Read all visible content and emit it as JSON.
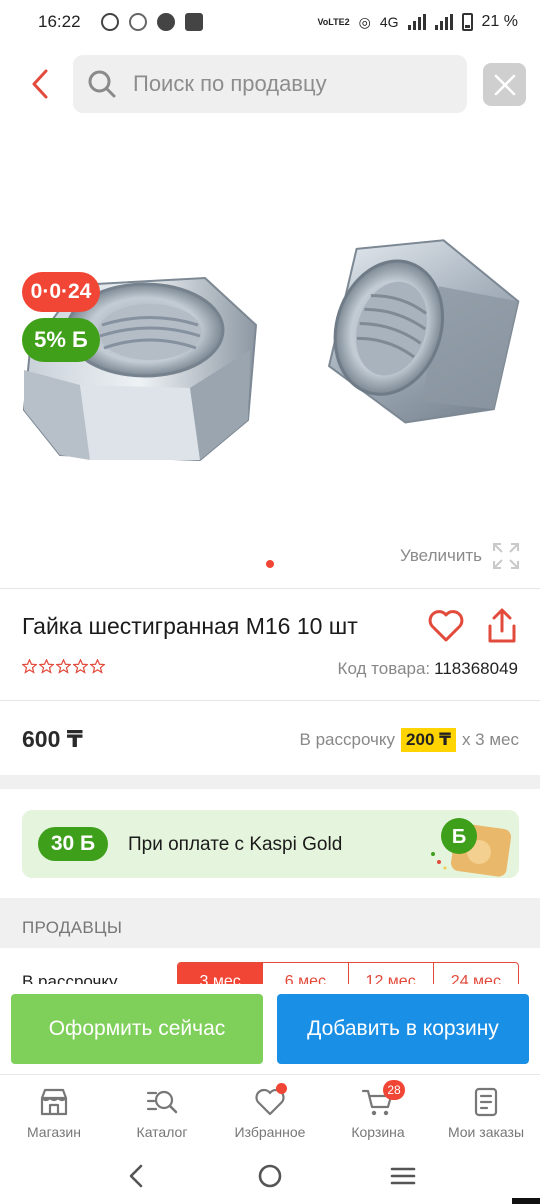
{
  "status_bar": {
    "time": "16:22",
    "network": "4G",
    "volte": "VoLTE2",
    "battery": "21 %"
  },
  "header": {
    "search_placeholder": "Поиск по продавцу",
    "back_icon": "chevron-left-icon",
    "close_icon": "close-icon"
  },
  "product": {
    "timer_badge": "0·0·24",
    "bonus_badge": "5% Б",
    "zoom_label": "Увеличить",
    "title": "Гайка шестигранная М16 10 шт",
    "rating": 0,
    "sku_label": "Код товара:",
    "sku_value": "118368049",
    "price": "600 ₸",
    "installment_prefix": "В рассрочку",
    "installment_amount": "200 ₸",
    "installment_suffix": "x 3 мес"
  },
  "kaspi_banner": {
    "bonus": "30 Б",
    "text": "При оплате с Kaspi Gold"
  },
  "sellers": {
    "title": "ПРОДАВЦЫ",
    "installment_label": "В рассрочку",
    "tabs": [
      "3 мес",
      "6 мес",
      "12 мес",
      "24 мес"
    ],
    "active_tab": "3 мес"
  },
  "actions": {
    "checkout": "Оформить сейчас",
    "add_to_cart": "Добавить в корзину"
  },
  "tab_bar": {
    "items": [
      {
        "label": "Магазин",
        "icon": "store-icon"
      },
      {
        "label": "Каталог",
        "icon": "catalog-search-icon"
      },
      {
        "label": "Избранное",
        "icon": "heart-icon"
      },
      {
        "label": "Корзина",
        "icon": "cart-icon"
      },
      {
        "label": "Мои заказы",
        "icon": "orders-icon"
      }
    ],
    "cart_count": "28"
  },
  "colors": {
    "accent_red": "#f14635",
    "kaspi_green": "#40a019",
    "cart_blue": "#1a8fe6",
    "checkout_green": "#7fd05a",
    "installment_yellow": "#ffd400"
  }
}
